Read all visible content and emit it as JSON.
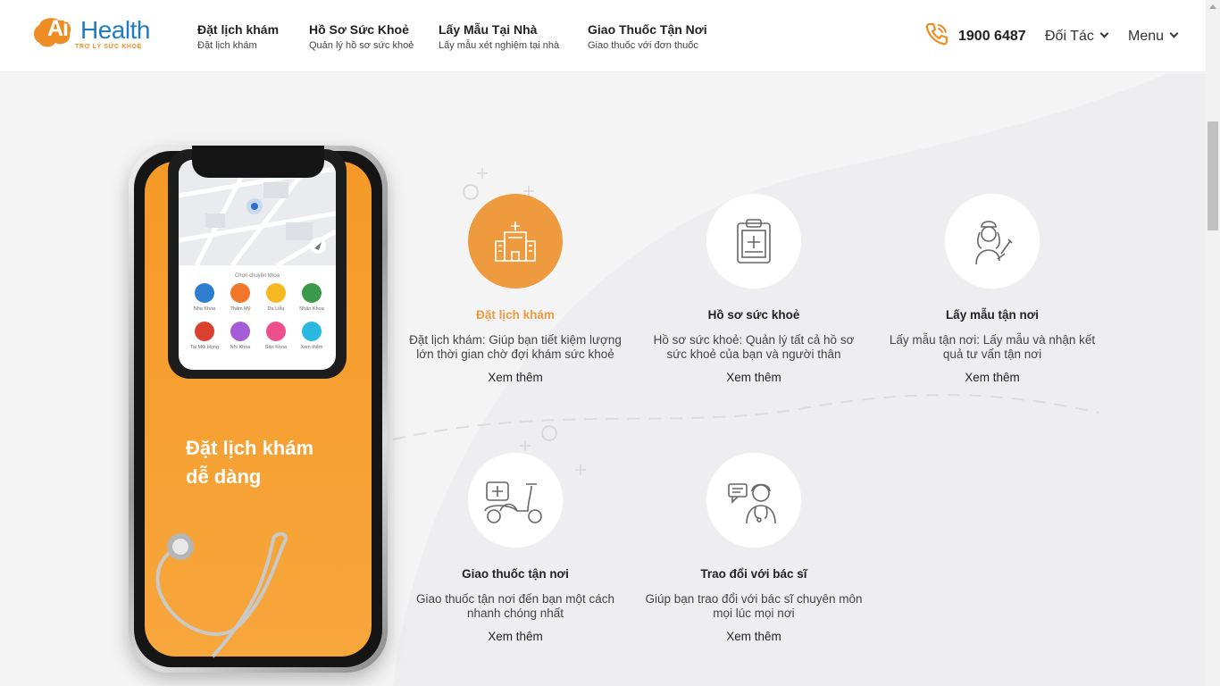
{
  "brand": {
    "logo_ai": "Ai",
    "logo_health": "Health",
    "logo_tagline": "TRỢ LÝ SỨC KHOẺ"
  },
  "nav": [
    {
      "title": "Đặt lịch khám",
      "subtitle": "Đặt lịch khám"
    },
    {
      "title": "Hồ Sơ Sức Khoẻ",
      "subtitle": "Quản lý hồ sơ sức khoẻ"
    },
    {
      "title": "Lấy Mẫu Tại Nhà",
      "subtitle": "Lấy mẫu xét nghiệm tại nhà"
    },
    {
      "title": "Giao Thuốc Tận Nơi",
      "subtitle": "Giao thuốc với đơn thuốc"
    }
  ],
  "header_right": {
    "hotline": "1900 6487",
    "partners": "Đối Tác",
    "menu": "Menu"
  },
  "phone_mockup": {
    "headline_line1": "Đặt lịch khám",
    "headline_line2": "dễ dàng",
    "sheet_title": "Chọn chuyên khoa",
    "specialties": [
      {
        "label": "Nha Khoa",
        "color": "#2f7fd1"
      },
      {
        "label": "Thẩm Mỹ",
        "color": "#f2772b"
      },
      {
        "label": "Da Liễu",
        "color": "#f5b820"
      },
      {
        "label": "Nhãn Khoa",
        "color": "#3b9a4a"
      },
      {
        "label": "Tai Mũi Họng",
        "color": "#d9412e"
      },
      {
        "label": "Nhi Khoa",
        "color": "#a65cd6"
      },
      {
        "label": "Sản Khoa",
        "color": "#ec4f8c"
      },
      {
        "label": "Xem thêm",
        "color": "#2bb8e0"
      }
    ]
  },
  "services": [
    {
      "title": "Đặt lịch khám",
      "desc": "Đặt lịch khám: Giúp bạn tiết kiệm lượng lớn thời gian chờ đợi khám sức khoẻ",
      "more": "Xem thêm",
      "icon": "hospital-icon",
      "active": true
    },
    {
      "title": "Hồ sơ sức khoẻ",
      "desc": "Hồ sơ sức khoẻ: Quản lý tất cả hồ sơ sức khoẻ của bạn và người thân",
      "more": "Xem thêm",
      "icon": "clipboard-icon",
      "active": false
    },
    {
      "title": "Lấy mẫu tận nơi",
      "desc": "Lấy mẫu tận nơi: Lấy mẫu và nhận kết quả tư vấn tận nơi",
      "more": "Xem thêm",
      "icon": "nurse-icon",
      "active": false
    },
    {
      "title": "Giao thuốc tận nơi",
      "desc": "Giao thuốc tận nơi đến bạn một cách nhanh chóng nhất",
      "more": "Xem thêm",
      "icon": "scooter-icon",
      "active": false
    },
    {
      "title": "Trao đổi với bác sĩ",
      "desc": "Giúp bạn trao đổi với bác sĩ chuyên môn mọi lúc mọi nơi",
      "more": "Xem thêm",
      "icon": "doctor-chat-icon",
      "active": false
    }
  ],
  "colors": {
    "accent": "#ee9b3f",
    "brand_blue": "#1f7bc4",
    "phone_orange": "#f59a28"
  }
}
